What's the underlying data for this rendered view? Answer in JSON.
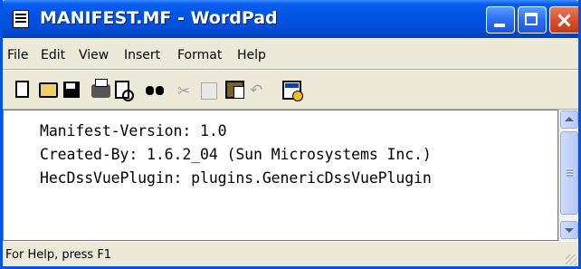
{
  "window": {
    "title": "MANIFEST.MF - WordPad",
    "app_icon": "wordpad-document-icon",
    "caption_buttons": [
      "minimize-icon",
      "maximize-icon",
      "close-icon"
    ]
  },
  "menu": {
    "items": [
      {
        "label": "File"
      },
      {
        "label": "Edit"
      },
      {
        "label": "View"
      },
      {
        "label": "Insert"
      },
      {
        "label": "Format"
      },
      {
        "label": "Help"
      }
    ]
  },
  "toolbar": {
    "icons": [
      "new-document-icon",
      "open-folder-icon",
      "save-disk-icon",
      "print-icon",
      "print-preview-icon",
      "find-binoculars-icon",
      "cut-scissors-icon",
      "copy-icon",
      "paste-clipboard-icon",
      "undo-icon",
      "date-time-icon"
    ]
  },
  "document": {
    "lines": [
      "Manifest-Version: 1.0",
      "Created-By: 1.6.2_04 (Sun Microsystems Inc.)",
      "HecDssVuePlugin: plugins.GenericDssVuePlugin"
    ]
  },
  "status": {
    "text": "For Help, press F1"
  },
  "colors": {
    "titlebar": "#0054e3",
    "chrome": "#ece9d8",
    "editor_bg": "#ffffff",
    "close_button": "#d8522e"
  }
}
